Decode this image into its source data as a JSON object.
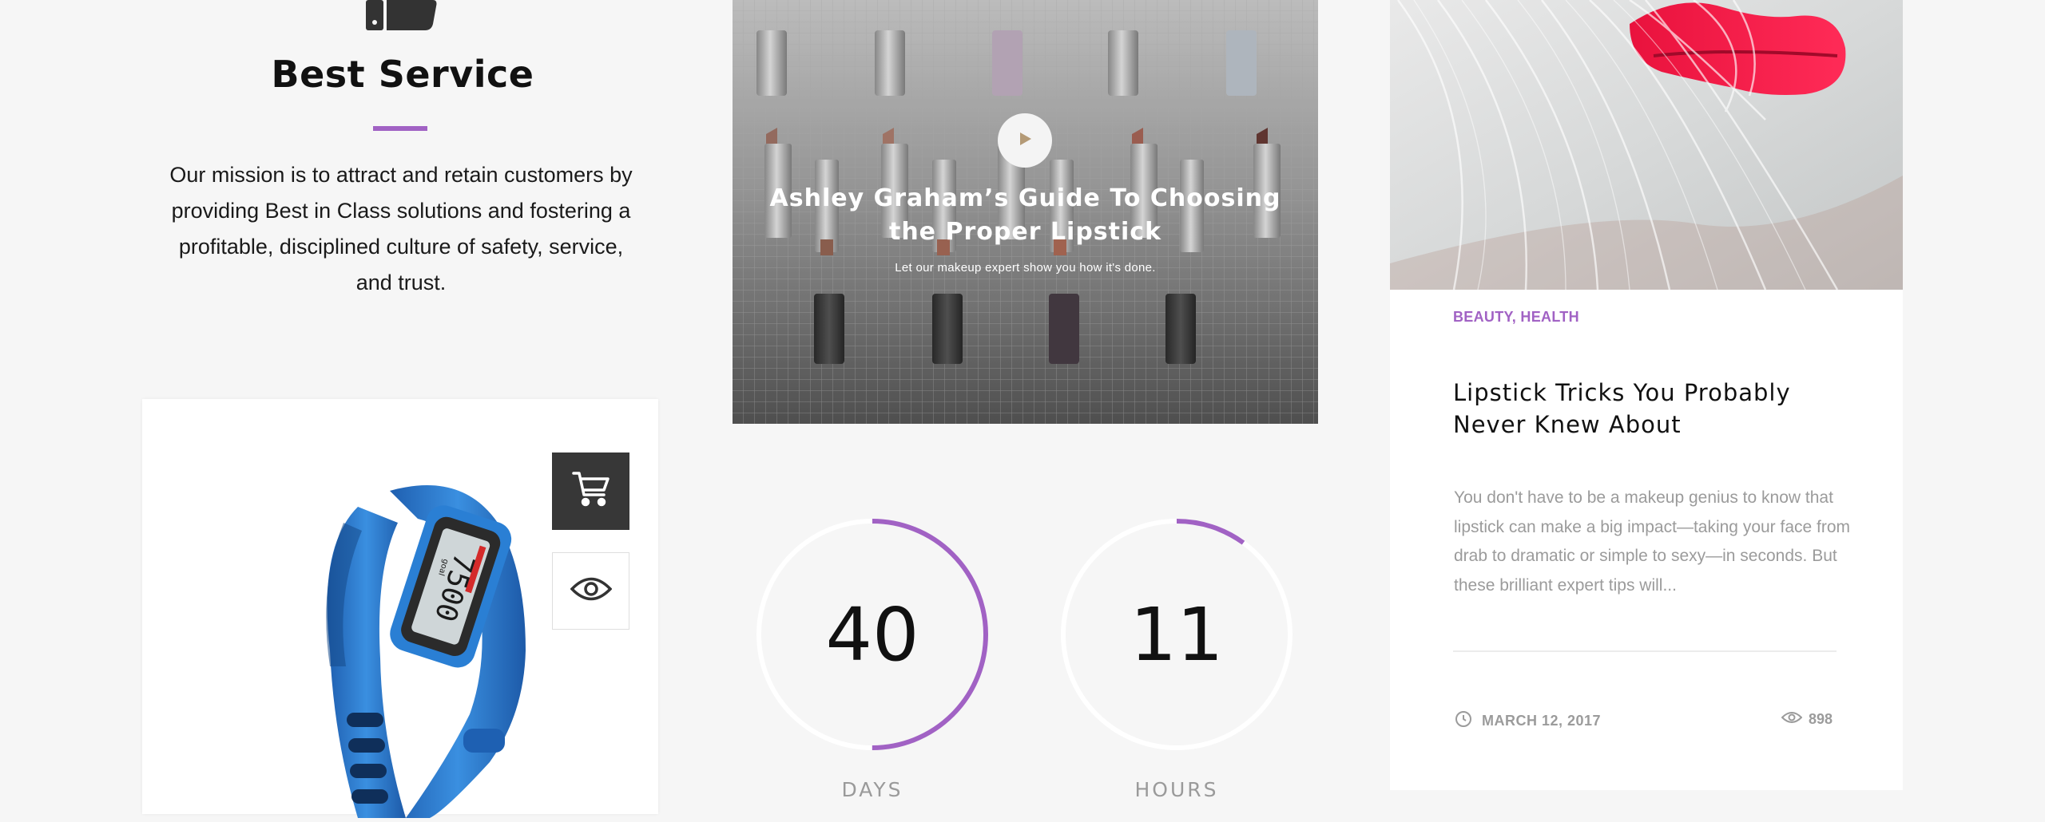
{
  "service": {
    "title": "Best Service",
    "description": "Our mission is to attract and retain customers by providing Best in Class solutions and fostering a profitable, disciplined culture of safety, service, and trust.",
    "icon": "thumbs-up-icon"
  },
  "product": {
    "image_icon": "fitness-band-icon",
    "display_value": "7500",
    "display_brand": "goal",
    "actions": {
      "cart_icon": "shopping-cart-icon",
      "view_icon": "eye-icon"
    }
  },
  "video": {
    "title": "Ashley Graham’s Guide To Choosing the Proper Lipstick",
    "subtitle": "Let our makeup expert show you how it's done.",
    "play_icon": "play-icon"
  },
  "countdown": {
    "days": {
      "value": "40",
      "label": "DAYS",
      "progress": 0.5
    },
    "hours": {
      "value": "11",
      "label": "HOURS",
      "progress": 0.1
    }
  },
  "blog": {
    "category": "BEAUTY, HEALTH",
    "title": "Lipstick Tricks You Probably Never Knew About",
    "excerpt": "You don't have to be a makeup genius to know that lipstick can make a big impact—taking your face from drab to dramatic or simple to sexy—in seconds. But these brilliant expert tips will...",
    "date": "MARCH 12, 2017",
    "views": "898",
    "date_icon": "clock-icon",
    "views_icon": "eye-icon"
  },
  "colors": {
    "accent": "#a162c4",
    "background": "#f6f6f6",
    "dark_button": "#373737",
    "muted_text": "#9b9b9b"
  }
}
